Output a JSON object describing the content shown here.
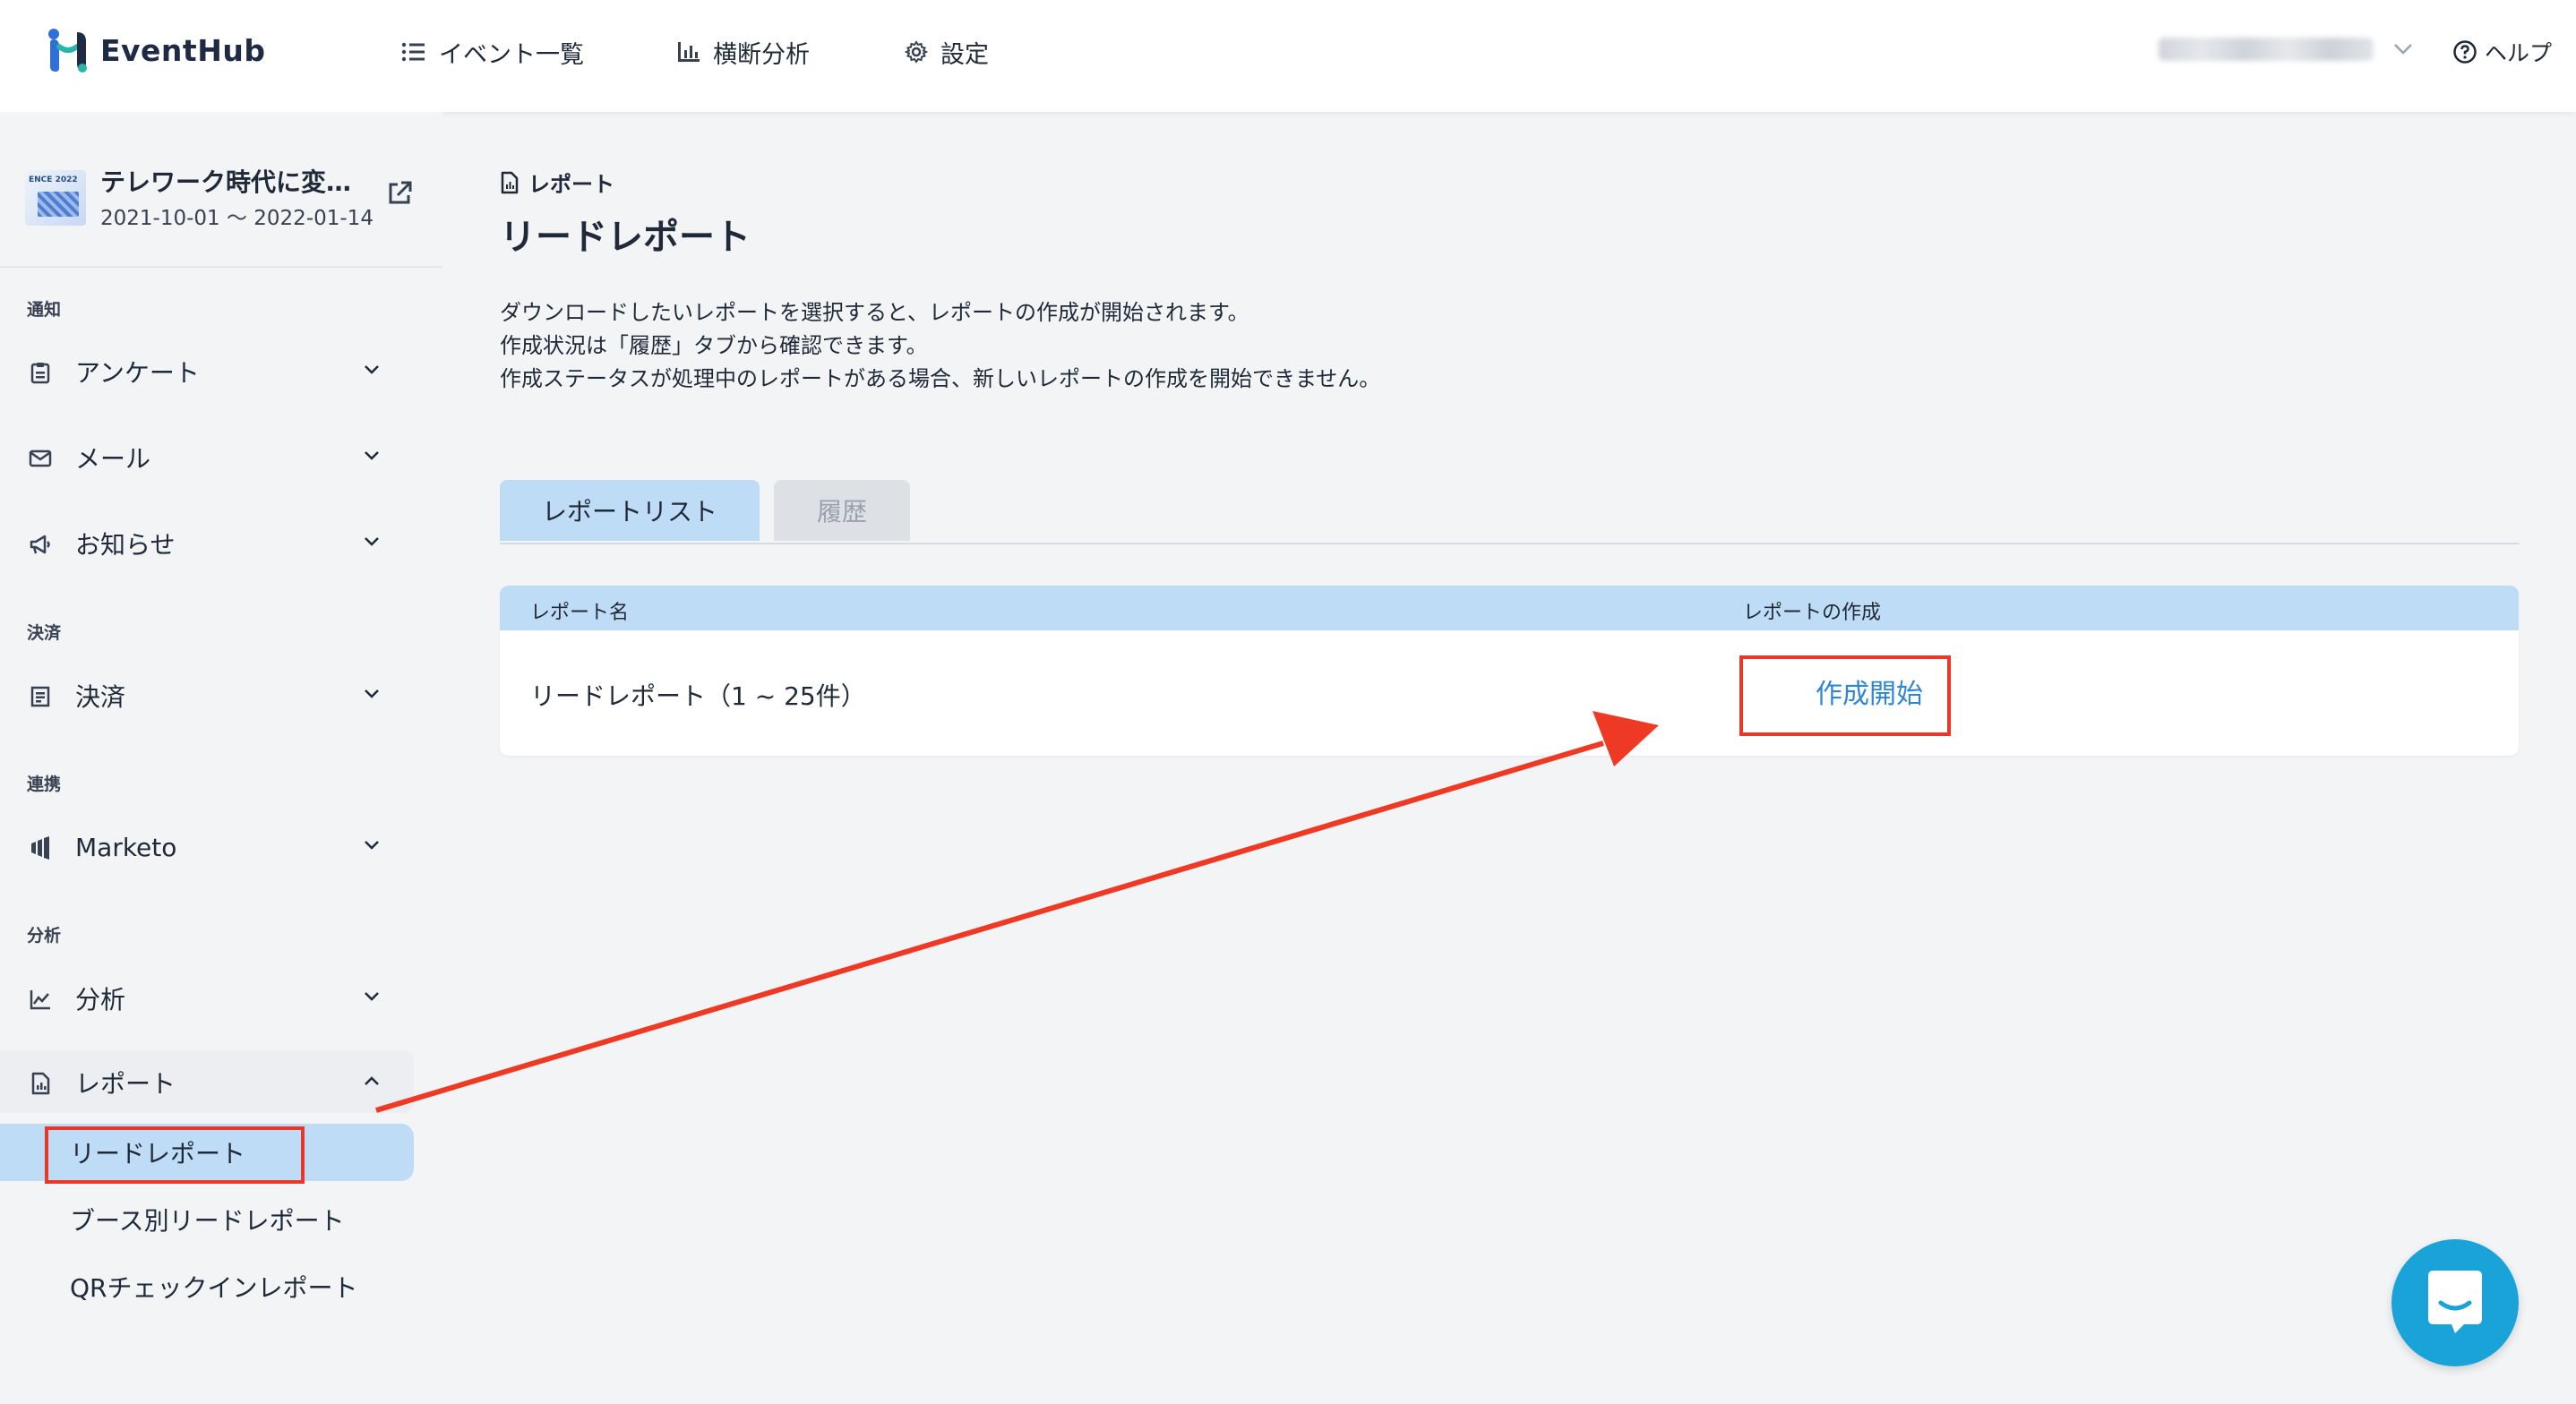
{
  "brand": {
    "name": "EventHub",
    "accent": "#2f6fd6"
  },
  "header": {
    "nav": [
      {
        "label": "イベント一覧",
        "icon": "list-icon"
      },
      {
        "label": "横断分析",
        "icon": "bar-chart-icon"
      },
      {
        "label": "設定",
        "icon": "gear-icon"
      }
    ],
    "help_label": "ヘルプ"
  },
  "sidebar": {
    "event": {
      "title": "テレワーク時代に変…",
      "dates": "2021-10-01 ～ 2022-01-14",
      "thumb_text": "ENCE 2022"
    },
    "sections": {
      "notify": "通知",
      "payment": "決済",
      "integration": "連携",
      "analysis": "分析"
    },
    "items": {
      "survey": "アンケート",
      "mail": "メール",
      "news": "お知らせ",
      "payment": "決済",
      "marketo": "Marketo",
      "analysis": "分析",
      "report": "レポート"
    },
    "sub_items": {
      "lead_report": "リードレポート",
      "booth_lead_report": "ブース別リードレポート",
      "qr_checkin_report": "QRチェックインレポート"
    }
  },
  "main": {
    "breadcrumb": "レポート",
    "title": "リードレポート",
    "description": [
      "ダウンロードしたいレポートを選択すると、レポートの作成が開始されます。",
      "作成状況は「履歴」タブから確認できます。",
      "作成ステータスが処理中のレポートがある場合、新しいレポートの作成を開始できません。"
    ],
    "tabs": {
      "report_list": "レポートリスト",
      "history": "履歴"
    },
    "table": {
      "headers": {
        "name": "レポート名",
        "create": "レポートの作成"
      },
      "rows": [
        {
          "name": "リードレポート（1 ~ 25件）",
          "action": "作成開始"
        }
      ]
    }
  }
}
